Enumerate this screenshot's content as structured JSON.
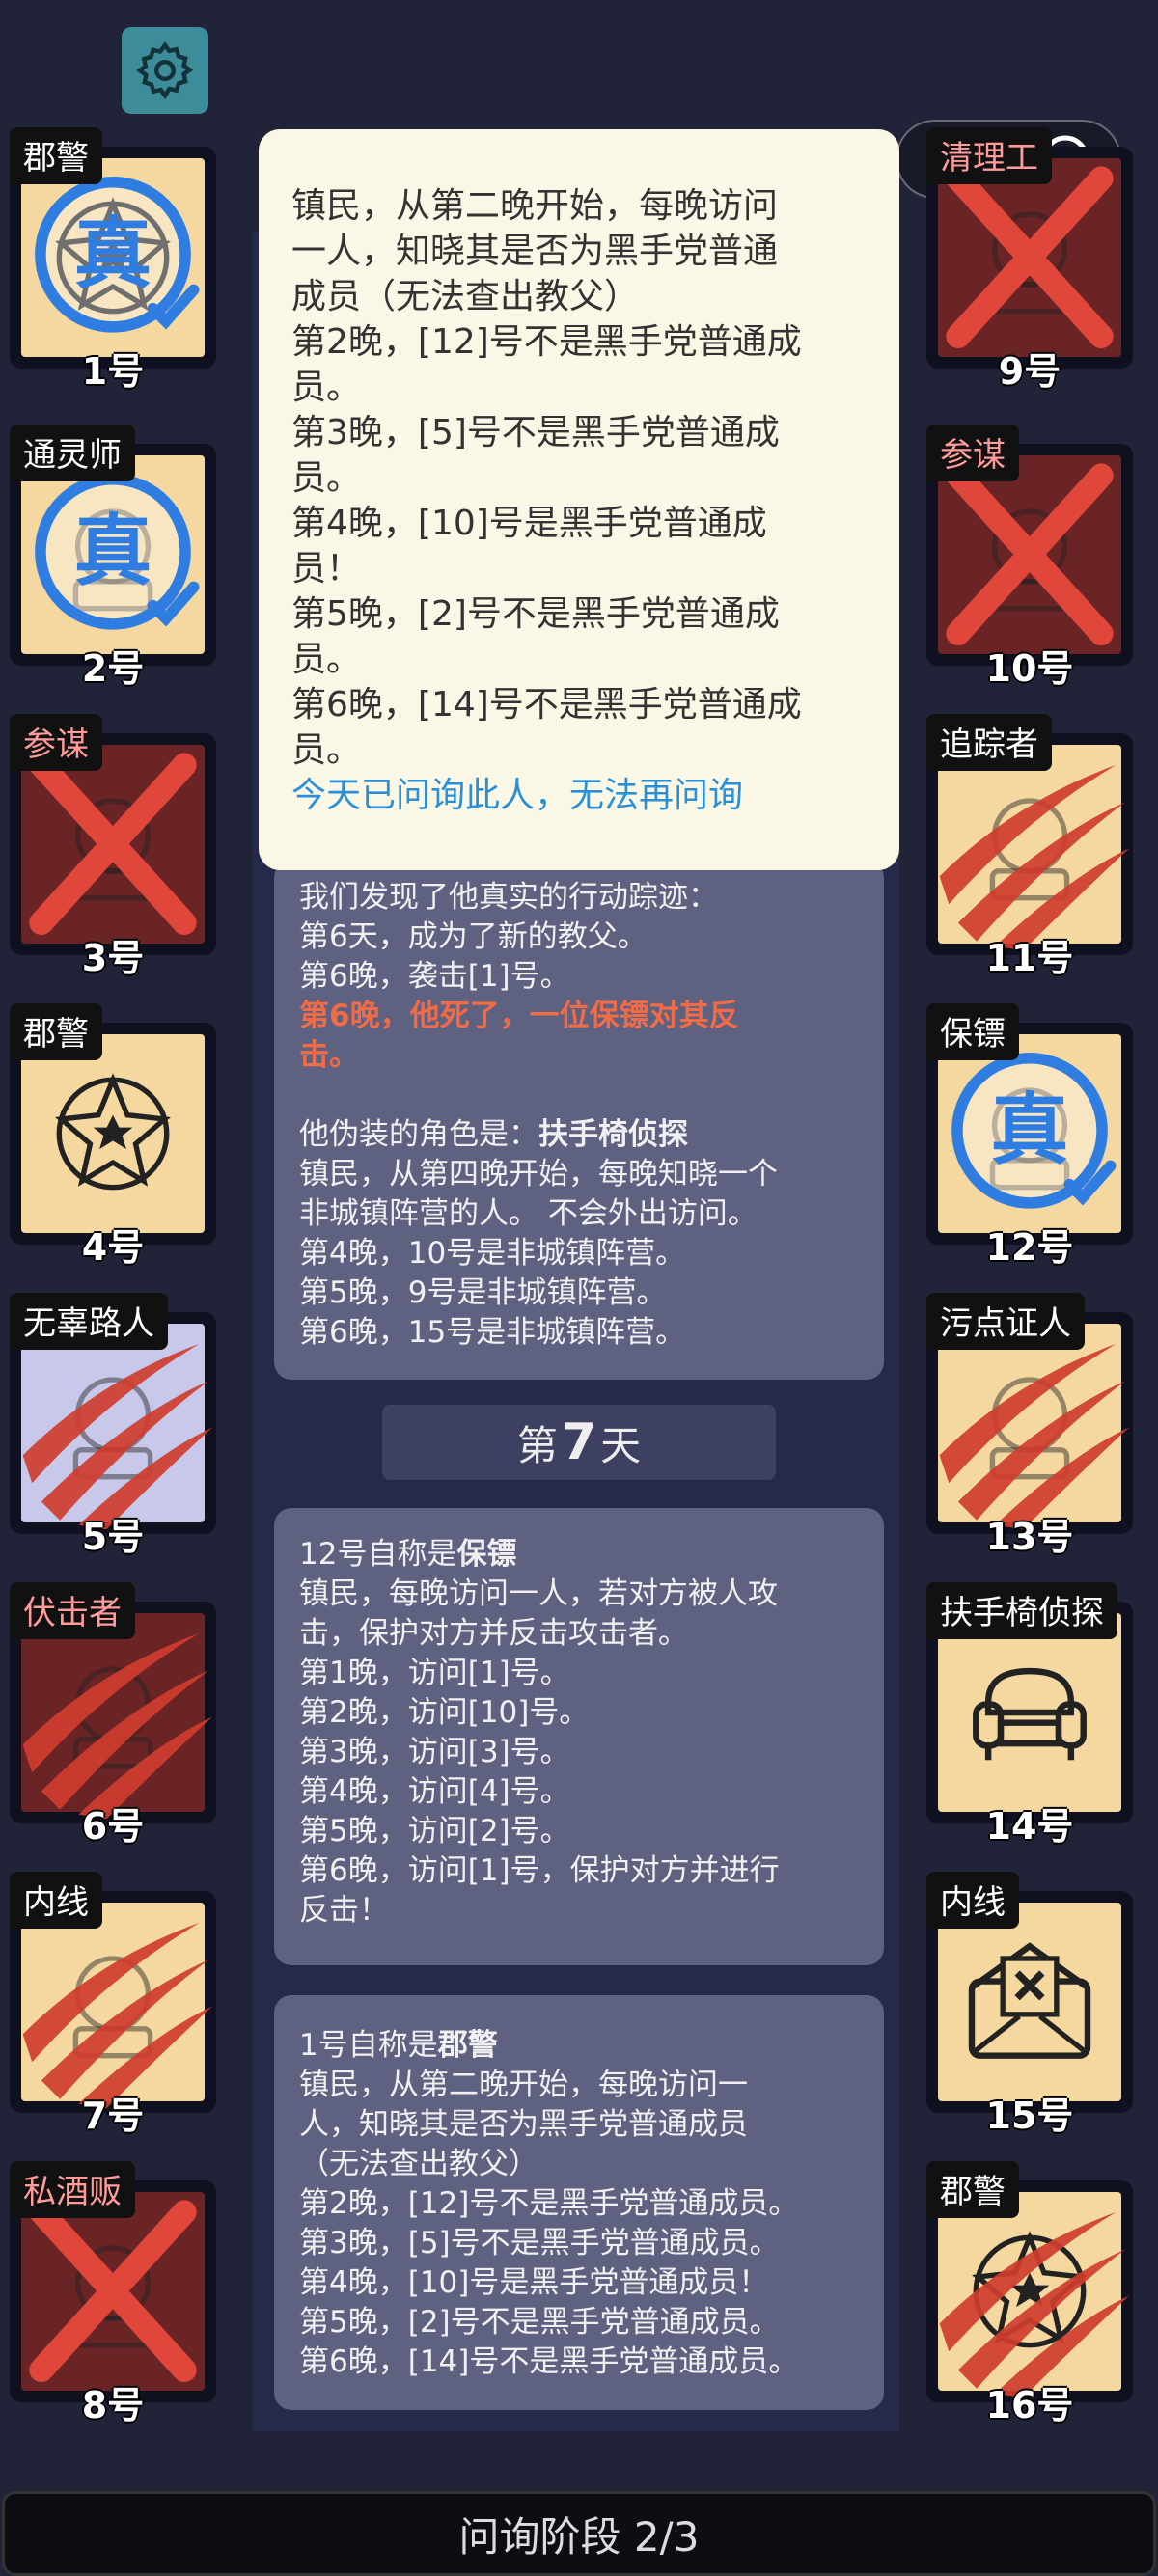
{
  "top": {
    "settings_icon": "gear-icon",
    "capsule_icons": [
      "more-icon",
      "record-icon"
    ]
  },
  "players": [
    {
      "number": "1号",
      "role": "郡警",
      "state": "verified"
    },
    {
      "number": "2号",
      "role": "通灵师",
      "state": "verified"
    },
    {
      "number": "3号",
      "role": "参谋",
      "state": "dead-x"
    },
    {
      "number": "4号",
      "role": "郡警",
      "state": "alive"
    },
    {
      "number": "5号",
      "role": "无辜路人",
      "state": "clawed"
    },
    {
      "number": "6号",
      "role": "伏击者",
      "state": "clawed"
    },
    {
      "number": "7号",
      "role": "内线",
      "state": "clawed"
    },
    {
      "number": "8号",
      "role": "私酒贩",
      "state": "dead-x"
    },
    {
      "number": "9号",
      "role": "清理工",
      "state": "dead-x"
    },
    {
      "number": "10号",
      "role": "参谋",
      "state": "dead-x"
    },
    {
      "number": "11号",
      "role": "追踪者",
      "state": "clawed"
    },
    {
      "number": "12号",
      "role": "保镖",
      "state": "verified"
    },
    {
      "number": "13号",
      "role": "污点证人",
      "state": "clawed"
    },
    {
      "number": "14号",
      "role": "扶手椅侦探",
      "state": "alive"
    },
    {
      "number": "15号",
      "role": "内线",
      "state": "alive"
    },
    {
      "number": "16号",
      "role": "郡警",
      "state": "clawed"
    }
  ],
  "badge_text": "真",
  "popup": {
    "lines": [
      "镇民，从第二晚开始，每晚访问",
      "一人，知晓其是否为黑手党普通",
      "成员（无法查出教父）",
      "第2晚，[12]号不是黑手党普通成",
      "员。",
      "第3晚，[5]号不是黑手党普通成",
      "员。",
      "第4晚，[10]号是黑手党普通成",
      "员！",
      "第5晚，[2]号不是黑手党普通成",
      "员。",
      "第6晚，[14]号不是黑手党普通成",
      "员。"
    ],
    "notice": "今天已问询此人，无法再问询"
  },
  "log1": {
    "lines_a": [
      "我们发现了他真实的行动踪迹：",
      "第6天，成为了新的教父。",
      "第6晚，袭击[1]号。"
    ],
    "death_lines": [
      "第6晚，他死了，一位保镖对其反",
      "击。"
    ],
    "disguise_prefix": "他伪装的角色是：",
    "disguise_role": "扶手椅侦探",
    "lines_b": [
      "镇民，从第四晚开始，每晚知晓一个",
      "非城镇阵营的人。 不会外出访问。",
      "第4晚，10号是非城镇阵营。",
      "第5晚，9号是非城镇阵营。",
      "第6晚，15号是非城镇阵营。"
    ]
  },
  "day_header": {
    "prefix": "第",
    "number": "7",
    "suffix": "天"
  },
  "log2": {
    "claim_prefix": "12号自称是",
    "claim_role": "保镖",
    "lines": [
      "镇民，每晚访问一人，若对方被人攻",
      "击，保护对方并反击攻击者。",
      "第1晚，访问[1]号。",
      "第2晚，访问[10]号。",
      "第3晚，访问[3]号。",
      "第4晚，访问[4]号。",
      "第5晚，访问[2]号。",
      "第6晚，访问[1]号，保护对方并进行",
      "反击！"
    ]
  },
  "log3": {
    "claim_prefix": "1号自称是",
    "claim_role": "郡警",
    "lines": [
      "镇民，从第二晚开始，每晚访问一",
      "人，知晓其是否为黑手党普通成员",
      "（无法查出教父）",
      "第2晚，[12]号不是黑手党普通成员。",
      "第3晚，[5]号不是黑手党普通成员。",
      "第4晚，[10]号是黑手党普通成员！",
      "第5晚，[2]号不是黑手党普通成员。",
      "第6晚，[14]号不是黑手党普通成员。"
    ]
  },
  "phase_label": "问询阶段 2/3",
  "colors": {
    "background": "#212338",
    "card_alive": "#f5d8a0",
    "card_dead": "#6a2426",
    "x_mark": "#e0473a",
    "claw": "#cf3d2e",
    "badge": "#2f7de0"
  }
}
